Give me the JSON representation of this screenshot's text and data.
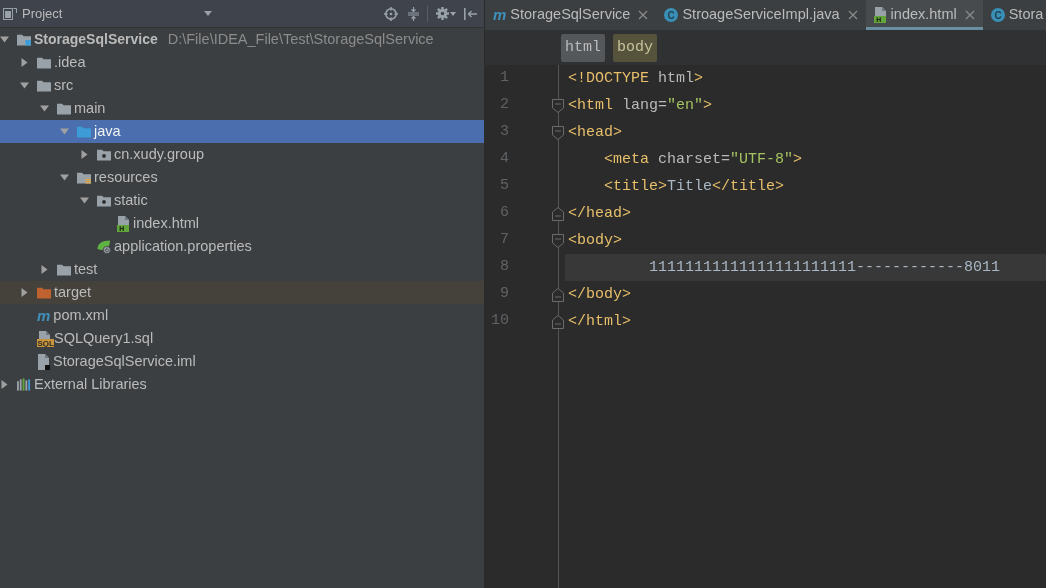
{
  "project_panel": {
    "title": "Project",
    "tree": [
      {
        "label": "StorageSqlService",
        "path": "D:\\File\\IDEA_File\\Test\\StorageSqlService",
        "kind": "module",
        "expanded": true,
        "selected": false,
        "children": [
          {
            "label": ".idea",
            "kind": "folder",
            "expanded": false,
            "selected": false
          },
          {
            "label": "src",
            "kind": "folder",
            "expanded": true,
            "selected": false,
            "children": [
              {
                "label": "main",
                "kind": "folder",
                "expanded": true,
                "selected": false,
                "children": [
                  {
                    "label": "java",
                    "kind": "source-folder",
                    "expanded": true,
                    "selected": true,
                    "children": [
                      {
                        "label": "cn.xudy.group",
                        "kind": "package",
                        "expanded": false,
                        "selected": false
                      }
                    ]
                  },
                  {
                    "label": "resources",
                    "kind": "resource-folder",
                    "expanded": true,
                    "selected": false,
                    "children": [
                      {
                        "label": "static",
                        "kind": "package",
                        "expanded": true,
                        "selected": false,
                        "children": [
                          {
                            "label": "index.html",
                            "kind": "html-file",
                            "badge": "H",
                            "selected": false
                          }
                        ]
                      },
                      {
                        "label": "application.properties",
                        "kind": "properties-file",
                        "selected": false
                      }
                    ]
                  }
                ]
              },
              {
                "label": "test",
                "kind": "folder",
                "expanded": false,
                "selected": false
              }
            ]
          },
          {
            "label": "target",
            "kind": "excluded-folder",
            "expanded": false,
            "selected": false
          },
          {
            "label": "pom.xml",
            "kind": "maven-file",
            "badge": "m",
            "selected": false
          },
          {
            "label": "SQLQuery1.sql",
            "kind": "sql-file",
            "badge": "SQL",
            "selected": false
          },
          {
            "label": "StorageSqlService.iml",
            "kind": "module-file",
            "selected": false
          }
        ]
      },
      {
        "label": "External Libraries",
        "kind": "libraries",
        "expanded": false,
        "selected": false
      }
    ]
  },
  "editor_tabs": [
    {
      "label": "StorageSqlService",
      "kind": "maven",
      "badge": "m",
      "selected": false,
      "close_button": true
    },
    {
      "label": "StroageServiceImpl.java",
      "kind": "class",
      "badge": "C",
      "selected": false,
      "close_button": true
    },
    {
      "label": "index.html",
      "kind": "html",
      "badge": "H",
      "selected": true,
      "close_button": true
    },
    {
      "label": "Stora",
      "kind": "class",
      "badge": "C",
      "selected": false,
      "close_button": false
    }
  ],
  "breadcrumbs": [
    {
      "label": "html",
      "selected": false
    },
    {
      "label": "body",
      "selected": true
    }
  ],
  "code_lines": [
    {
      "number": "1",
      "kind": "plain",
      "current": false,
      "tokens": [
        {
          "text": "<!DOCTYPE",
          "kind": "tag"
        },
        {
          "text": " html",
          "kind": "attr"
        },
        {
          "text": ">",
          "kind": "tag"
        }
      ]
    },
    {
      "number": "2",
      "kind": "fold-start",
      "current": false,
      "tokens": [
        {
          "text": "<html",
          "kind": "tag"
        },
        {
          "text": " lang=",
          "kind": "attr"
        },
        {
          "text": "\"en\"",
          "kind": "value"
        },
        {
          "text": ">",
          "kind": "tag"
        }
      ]
    },
    {
      "number": "3",
      "kind": "fold-start",
      "current": false,
      "tokens": [
        {
          "text": "<head>",
          "kind": "tag"
        }
      ]
    },
    {
      "number": "4",
      "kind": "plain",
      "current": false,
      "tokens": [
        {
          "text": "    <meta",
          "kind": "tag"
        },
        {
          "text": " charset=",
          "kind": "attr"
        },
        {
          "text": "\"UTF-8\"",
          "kind": "value"
        },
        {
          "text": ">",
          "kind": "tag"
        }
      ]
    },
    {
      "number": "5",
      "kind": "plain",
      "current": false,
      "tokens": [
        {
          "text": "    <title>",
          "kind": "tag"
        },
        {
          "text": "Title",
          "kind": "text"
        },
        {
          "text": "</title>",
          "kind": "tag"
        }
      ]
    },
    {
      "number": "6",
      "kind": "fold-end",
      "current": false,
      "tokens": [
        {
          "text": "</head>",
          "kind": "tag"
        }
      ]
    },
    {
      "number": "7",
      "kind": "fold-start",
      "current": false,
      "tokens": [
        {
          "text": "<body>",
          "kind": "tag"
        }
      ]
    },
    {
      "number": "8",
      "kind": "plain",
      "current": true,
      "tokens": [
        {
          "text": "         11111111111111111111111------------8011",
          "kind": "text"
        }
      ]
    },
    {
      "number": "9",
      "kind": "fold-end",
      "current": false,
      "tokens": [
        {
          "text": "</body>",
          "kind": "tag"
        }
      ]
    },
    {
      "number": "10",
      "kind": "fold-end",
      "current": false,
      "tokens": [
        {
          "text": "</html>",
          "kind": "tag"
        }
      ]
    }
  ]
}
